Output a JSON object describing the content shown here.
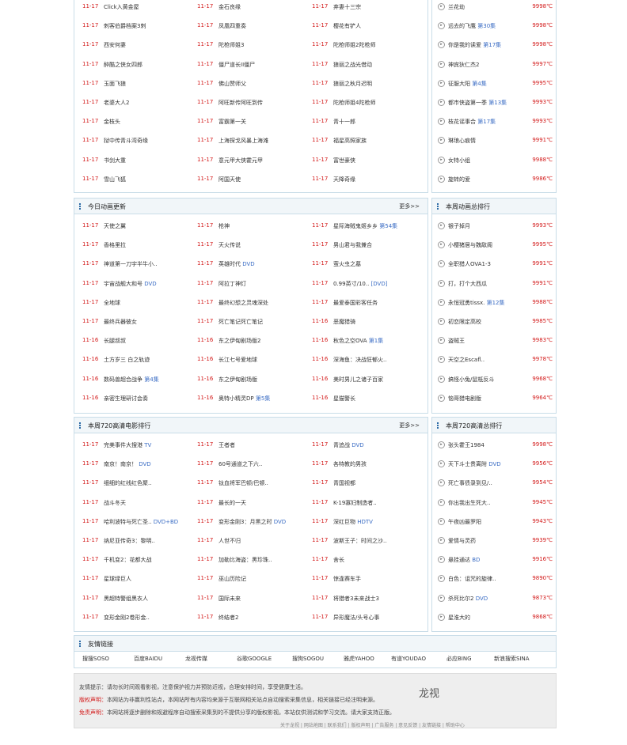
{
  "section1": {
    "items": [
      {
        "d": "11-17",
        "n": "Click入黄金屋",
        "x": ""
      },
      {
        "d": "11-17",
        "n": "金石良缘",
        "x": ""
      },
      {
        "d": "11-17",
        "n": "弃妻十三宗",
        "x": ""
      },
      {
        "d": "11-17",
        "n": "刺客伯爵档案3刺",
        "x": ""
      },
      {
        "d": "11-17",
        "n": "凤凰四重奏",
        "x": ""
      },
      {
        "d": "11-17",
        "n": "樱花有铲人",
        "x": ""
      },
      {
        "d": "11-17",
        "n": "西安何妻",
        "x": ""
      },
      {
        "d": "11-17",
        "n": "陀枪师姐3",
        "x": ""
      },
      {
        "d": "11-17",
        "n": "陀枪师姐2陀枪师",
        "x": ""
      },
      {
        "d": "11-17",
        "n": "醉酷之侠女四郎",
        "x": ""
      },
      {
        "d": "11-17",
        "n": "僵尸道长II僵尸",
        "x": ""
      },
      {
        "d": "11-17",
        "n": "狼丽之战光借动",
        "x": ""
      },
      {
        "d": "11-17",
        "n": "玉面飞狼",
        "x": ""
      },
      {
        "d": "11-17",
        "n": "佛山赞师父",
        "x": ""
      },
      {
        "d": "11-17",
        "n": "狼丽之秋月迟明",
        "x": ""
      },
      {
        "d": "11-17",
        "n": "老婆大人2",
        "x": ""
      },
      {
        "d": "11-17",
        "n": "阿旺新传阿旺到传",
        "x": ""
      },
      {
        "d": "11-17",
        "n": "陀枪师姐4陀枪师",
        "x": ""
      },
      {
        "d": "11-17",
        "n": "金枝头",
        "x": ""
      },
      {
        "d": "11-17",
        "n": "富霸第一关",
        "x": ""
      },
      {
        "d": "11-17",
        "n": "青十一郎",
        "x": ""
      },
      {
        "d": "11-17",
        "n": "狱中传青斗湾奇缘",
        "x": ""
      },
      {
        "d": "11-17",
        "n": "上海探戈风暴上海滩",
        "x": ""
      },
      {
        "d": "11-17",
        "n": "福星高照家族",
        "x": ""
      },
      {
        "d": "11-17",
        "n": "书剑大重",
        "x": ""
      },
      {
        "d": "11-17",
        "n": "意元甲大侠霍元甲",
        "x": ""
      },
      {
        "d": "11-17",
        "n": "富世豪侠",
        "x": ""
      },
      {
        "d": "11-17",
        "n": "雪山飞狐",
        "x": ""
      },
      {
        "d": "11-17",
        "n": "阿国天使",
        "x": ""
      },
      {
        "d": "11-17",
        "n": "天降奇缘",
        "x": ""
      }
    ]
  },
  "rank1": {
    "items": [
      {
        "n": "兰花劫",
        "x": "",
        "h": "9998℃"
      },
      {
        "n": "远去的飞鹰",
        "x": "第30集",
        "h": "9998℃"
      },
      {
        "n": "你是我的读爱",
        "x": "第17集",
        "h": "9998℃"
      },
      {
        "n": "神宾狄仁杰2",
        "x": "",
        "h": "9997℃"
      },
      {
        "n": "征服大阳",
        "x": "第4集",
        "h": "9995℃"
      },
      {
        "n": "都市侠盗第一季",
        "x": "第13集",
        "h": "9993℃"
      },
      {
        "n": "枝花谣事合",
        "x": "第17集",
        "h": "9993℃"
      },
      {
        "n": "琳琅心痕情",
        "x": "",
        "h": "9991℃"
      },
      {
        "n": "女特小组",
        "x": "",
        "h": "9988℃"
      },
      {
        "n": "旋转的爱",
        "x": "",
        "h": "9986℃"
      }
    ]
  },
  "section2": {
    "title": "今日动画更新",
    "more": "更多>>",
    "items": [
      {
        "d": "11-17",
        "n": "天使之翼",
        "x": ""
      },
      {
        "d": "11-17",
        "n": "枪神",
        "x": ""
      },
      {
        "d": "11-17",
        "n": "星际海贼鬼姬乡乡",
        "x": "第54集"
      },
      {
        "d": "11-17",
        "n": "香格里拉",
        "x": ""
      },
      {
        "d": "11-17",
        "n": "天火传说",
        "x": ""
      },
      {
        "d": "11-17",
        "n": "男山君与我兼合",
        "x": ""
      },
      {
        "d": "11-17",
        "n": "神道第一刀宇半牛小..",
        "x": ""
      },
      {
        "d": "11-17",
        "n": "英雄时代",
        "x": "DVD"
      },
      {
        "d": "11-17",
        "n": "萤火虫之墓",
        "x": ""
      },
      {
        "d": "11-17",
        "n": "宇宙战舰大和号",
        "x": "DVD"
      },
      {
        "d": "11-17",
        "n": "阿拉丁神灯",
        "x": ""
      },
      {
        "d": "11-17",
        "n": "0.99英寸/10..",
        "x": "[DVD]"
      },
      {
        "d": "11-17",
        "n": "全地球",
        "x": ""
      },
      {
        "d": "11-17",
        "n": "最终幻想之灵魂深处",
        "x": ""
      },
      {
        "d": "11-17",
        "n": "最爱泰国彩客任务",
        "x": ""
      },
      {
        "d": "11-17",
        "n": "最终兵器彼女",
        "x": ""
      },
      {
        "d": "11-17",
        "n": "死亡笔记死亡笔记",
        "x": ""
      },
      {
        "d": "11-16",
        "n": "恶魔猎骑",
        "x": ""
      },
      {
        "d": "11-16",
        "n": "长腿叔叔",
        "x": ""
      },
      {
        "d": "11-16",
        "n": "东之伊甸剧场版2",
        "x": ""
      },
      {
        "d": "11-16",
        "n": "秋色之空OVA",
        "x": "第1集"
      },
      {
        "d": "11-16",
        "n": "土方岁三 白之轨迹",
        "x": ""
      },
      {
        "d": "11-16",
        "n": "长江七号爱地球",
        "x": ""
      },
      {
        "d": "11-16",
        "n": "深海鱼：决战狂郁火..",
        "x": ""
      },
      {
        "d": "11-16",
        "n": "数码兽超合战争",
        "x": "第4集"
      },
      {
        "d": "11-16",
        "n": "东之伊甸剧场版",
        "x": ""
      },
      {
        "d": "11-16",
        "n": "美时男儿之诸子百家",
        "x": ""
      },
      {
        "d": "11-16",
        "n": "亲密生理研讨会奏",
        "x": ""
      },
      {
        "d": "11-16",
        "n": "奥特小精灵DP",
        "x": "第5集"
      },
      {
        "d": "11-16",
        "n": "星猫警长",
        "x": ""
      }
    ]
  },
  "rank2": {
    "title": "本周动画总排行",
    "items": [
      {
        "n": "银子掉月",
        "x": "",
        "h": "9993℃"
      },
      {
        "n": "小樱猪居与魏敌阁",
        "x": "",
        "h": "9995℃"
      },
      {
        "n": "全职猎人OVA1-3",
        "x": "",
        "h": "9991℃"
      },
      {
        "n": "打，打个大西瓜",
        "x": "",
        "h": "9991℃"
      },
      {
        "n": "永恒冠勇tissx.",
        "x": "第12集",
        "h": "9988℃"
      },
      {
        "n": "初恋限定高校",
        "x": "",
        "h": "9985℃"
      },
      {
        "n": "盗贼王",
        "x": "",
        "h": "9983℃"
      },
      {
        "n": "天空之Escafl..",
        "x": "",
        "h": "9978℃"
      },
      {
        "n": "搞怪小兔/鼠柢反斗",
        "x": "",
        "h": "9968℃"
      },
      {
        "n": "恼哥猎电剧版",
        "x": "",
        "h": "9964℃"
      }
    ]
  },
  "section3": {
    "title": "本周720高清电影排行",
    "more": "更多>>",
    "items": [
      {
        "d": "11-17",
        "n": "完美事件大搜港",
        "x": "TV"
      },
      {
        "d": "11-17",
        "n": "王者者",
        "x": ""
      },
      {
        "d": "11-17",
        "n": "青追战",
        "x": "DVD"
      },
      {
        "d": "11-17",
        "n": "南京！南京！",
        "x": "DVD"
      },
      {
        "d": "11-17",
        "n": "60号通道之下六..",
        "x": ""
      },
      {
        "d": "11-17",
        "n": "各特教的男孩",
        "x": ""
      },
      {
        "d": "11-17",
        "n": "细细的红线红色聚..",
        "x": ""
      },
      {
        "d": "11-17",
        "n": "钛血将军巴顿/巴顿..",
        "x": ""
      },
      {
        "d": "11-17",
        "n": "青国视都",
        "x": ""
      },
      {
        "d": "11-17",
        "n": "战斗冬天",
        "x": ""
      },
      {
        "d": "11-17",
        "n": "最长的一天",
        "x": ""
      },
      {
        "d": "11-17",
        "n": "K-19寡妇制造者..",
        "x": ""
      },
      {
        "d": "11-17",
        "n": "哈利波特与死亡圣..",
        "x": "DVD+BD"
      },
      {
        "d": "11-17",
        "n": "变形金刚3：月黑之时",
        "x": "DVD"
      },
      {
        "d": "11-17",
        "n": "深红巨物",
        "x": "HDTV"
      },
      {
        "d": "11-17",
        "n": "纳尼亚传奇3：黎明..",
        "x": ""
      },
      {
        "d": "11-17",
        "n": "人世不归",
        "x": ""
      },
      {
        "d": "11-17",
        "n": "波斯王子：时间之沙..",
        "x": ""
      },
      {
        "d": "11-17",
        "n": "千机变2：花都大战",
        "x": ""
      },
      {
        "d": "11-17",
        "n": "加勒比海盗：黑珍珠..",
        "x": ""
      },
      {
        "d": "11-17",
        "n": "舍长",
        "x": ""
      },
      {
        "d": "11-17",
        "n": "星球绿巨人",
        "x": ""
      },
      {
        "d": "11-17",
        "n": "巫山历险记",
        "x": ""
      },
      {
        "d": "11-17",
        "n": "惊逢赛车手",
        "x": ""
      },
      {
        "d": "11-17",
        "n": "黑超特警组黑衣人",
        "x": ""
      },
      {
        "d": "11-17",
        "n": "国际未来",
        "x": ""
      },
      {
        "d": "11-17",
        "n": "将猎者3未来战士3",
        "x": ""
      },
      {
        "d": "11-17",
        "n": "变形金刚2卷形金..",
        "x": ""
      },
      {
        "d": "11-17",
        "n": "终结者2",
        "x": ""
      },
      {
        "d": "11-17",
        "n": "异形魔法/头号心事",
        "x": ""
      }
    ]
  },
  "rank3": {
    "title": "本周720高清总排行",
    "items": [
      {
        "n": "张头霍王1984",
        "x": "",
        "h": "9998℃"
      },
      {
        "n": "天下斗士贵离附",
        "x": "DVD",
        "h": "9956℃"
      },
      {
        "n": "死亡事债录到见/..",
        "x": "",
        "h": "9954℃"
      },
      {
        "n": "你出我出生死大..",
        "x": "",
        "h": "9945℃"
      },
      {
        "n": "午夜凶最罗阳",
        "x": "",
        "h": "9943℃"
      },
      {
        "n": "爱情与灵药",
        "x": "",
        "h": "9939℃"
      },
      {
        "n": "悬挂通达",
        "x": "BD",
        "h": "9916℃"
      },
      {
        "n": "白色：诅咒的旋律..",
        "x": "",
        "h": "9890℃"
      },
      {
        "n": "杀死比尔2",
        "x": "DVD",
        "h": "9873℃"
      },
      {
        "n": "星淮大的",
        "x": "",
        "h": "9868℃"
      }
    ]
  },
  "links": {
    "title": "友情链接",
    "items": [
      "搜搜SOSO",
      "百度BAIDU",
      "龙视传媒",
      "谷歌GOOGLE",
      "搜狗SOGOU",
      "雅虎YAHOO",
      "有道YOUDAO",
      "必应BING",
      "新浪搜索SINA"
    ]
  },
  "footer": {
    "line1": "友情提示：请勿长时间观看影视，注意保护视力并预防近视，合理安排时间，享受健康生活。",
    "line2_label": "版权声明：",
    "line2": "本网站为非赢利性站点，本网站所有内容均来源于互联网相关站点自动搜索采集信息，相关链接已经注明来源。",
    "line3_label": "免责声明：",
    "line3": "本网站将逐步删除和规避程序自动搜索采集到的不提供分享的版权影视。本站仅供测试和学习交流。请大家支持正版。",
    "sig": "龙视",
    "bottom": "关于龙视 | 网站地图 | 联系我们 | 版权声明 | 广告服务 | 意见反馈 | 友情链接 | 帮助中心"
  }
}
